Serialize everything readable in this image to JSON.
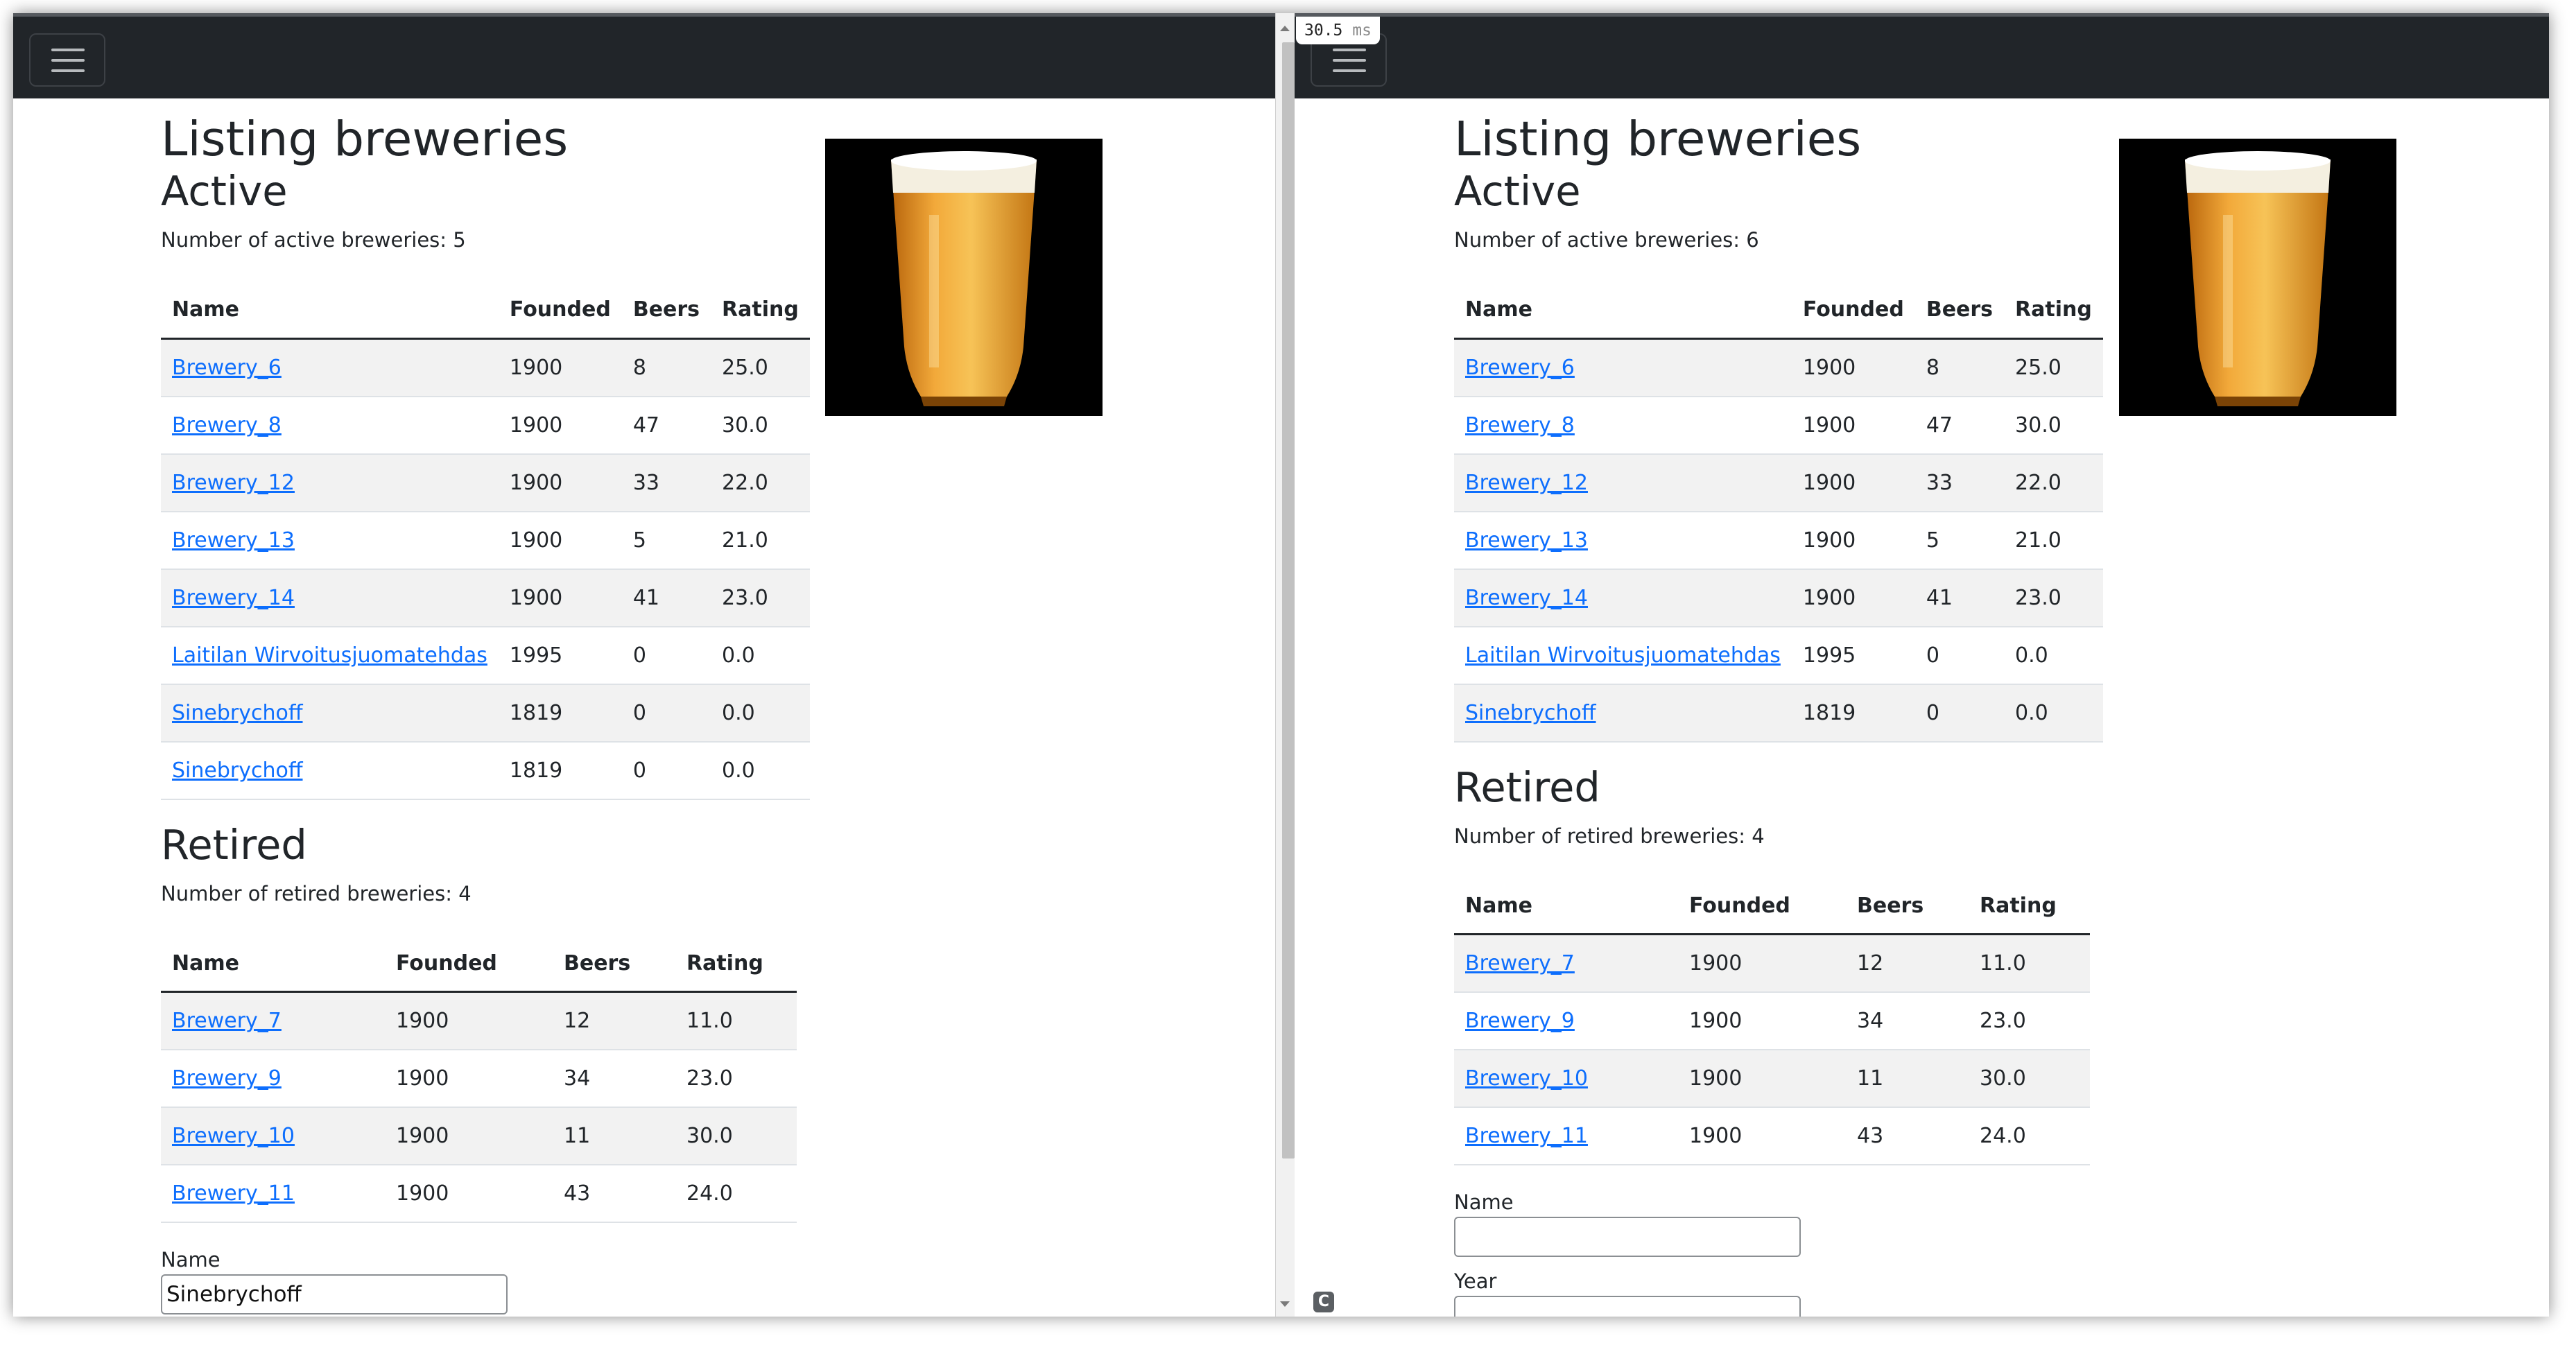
{
  "timer": {
    "value": "30.5",
    "unit": "ms"
  },
  "footer_icon_letter": "C",
  "colors": {
    "navbar": "#212529",
    "link": "#0d6efd",
    "stripe": "#f2f2f2"
  },
  "left": {
    "title": "Listing breweries",
    "active": {
      "heading": "Active",
      "count_text": "Number of active breweries: 5",
      "headers": [
        "Name",
        "Founded",
        "Beers",
        "Rating"
      ],
      "rows": [
        [
          "Brewery_6",
          "1900",
          "8",
          "25.0"
        ],
        [
          "Brewery_8",
          "1900",
          "47",
          "30.0"
        ],
        [
          "Brewery_12",
          "1900",
          "33",
          "22.0"
        ],
        [
          "Brewery_13",
          "1900",
          "5",
          "21.0"
        ],
        [
          "Brewery_14",
          "1900",
          "41",
          "23.0"
        ],
        [
          "Laitilan Wirvoitusjuomatehdas",
          "1995",
          "0",
          "0.0"
        ],
        [
          "Sinebrychoff",
          "1819",
          "0",
          "0.0"
        ],
        [
          "Sinebrychoff",
          "1819",
          "0",
          "0.0"
        ]
      ]
    },
    "retired": {
      "heading": "Retired",
      "count_text": "Number of retired breweries: 4",
      "headers": [
        "Name",
        "Founded",
        "Beers",
        "Rating"
      ],
      "rows": [
        [
          "Brewery_7",
          "1900",
          "12",
          "11.0"
        ],
        [
          "Brewery_9",
          "1900",
          "34",
          "23.0"
        ],
        [
          "Brewery_10",
          "1900",
          "11",
          "30.0"
        ],
        [
          "Brewery_11",
          "1900",
          "43",
          "24.0"
        ]
      ]
    },
    "form": {
      "name_label": "Name",
      "name_value": "Sinebrychoff"
    }
  },
  "right": {
    "title": "Listing breweries",
    "active": {
      "heading": "Active",
      "count_text": "Number of active breweries: 6",
      "headers": [
        "Name",
        "Founded",
        "Beers",
        "Rating"
      ],
      "rows": [
        [
          "Brewery_6",
          "1900",
          "8",
          "25.0"
        ],
        [
          "Brewery_8",
          "1900",
          "47",
          "30.0"
        ],
        [
          "Brewery_12",
          "1900",
          "33",
          "22.0"
        ],
        [
          "Brewery_13",
          "1900",
          "5",
          "21.0"
        ],
        [
          "Brewery_14",
          "1900",
          "41",
          "23.0"
        ],
        [
          "Laitilan Wirvoitusjuomatehdas",
          "1995",
          "0",
          "0.0"
        ],
        [
          "Sinebrychoff",
          "1819",
          "0",
          "0.0"
        ]
      ]
    },
    "retired": {
      "heading": "Retired",
      "count_text": "Number of retired breweries: 4",
      "headers": [
        "Name",
        "Founded",
        "Beers",
        "Rating"
      ],
      "rows": [
        [
          "Brewery_7",
          "1900",
          "12",
          "11.0"
        ],
        [
          "Brewery_9",
          "1900",
          "34",
          "23.0"
        ],
        [
          "Brewery_10",
          "1900",
          "11",
          "30.0"
        ],
        [
          "Brewery_11",
          "1900",
          "43",
          "24.0"
        ]
      ]
    },
    "form": {
      "name_label": "Name",
      "name_value": "",
      "year_label": "Year",
      "year_value": ""
    }
  }
}
